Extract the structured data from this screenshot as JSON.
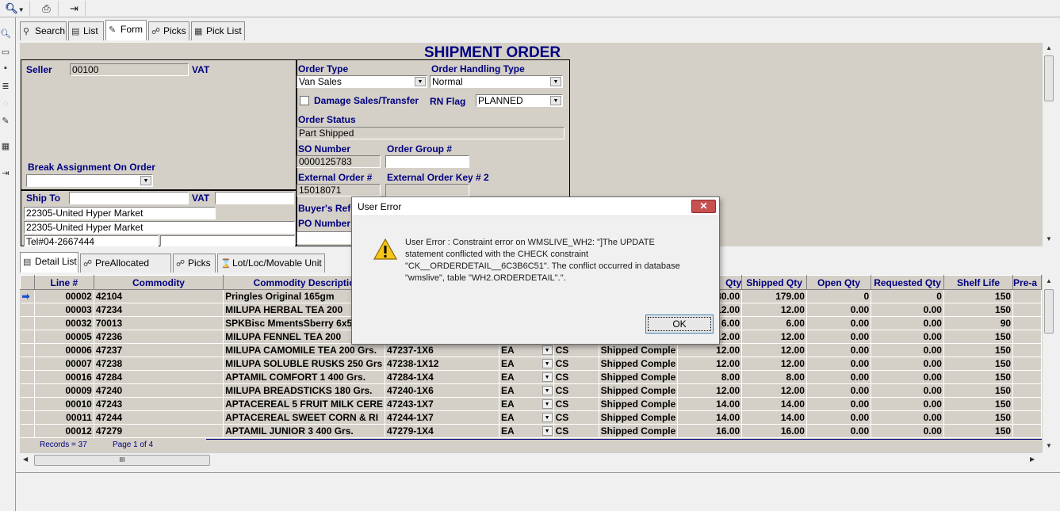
{
  "toolbar": {
    "items": [
      "search-dropdown-icon",
      "print-icon",
      "exit-icon"
    ]
  },
  "main_tabs": [
    {
      "label": "Search",
      "icon": "search-icon"
    },
    {
      "label": "List",
      "icon": "list-icon"
    },
    {
      "label": "Form",
      "icon": "form-icon"
    },
    {
      "label": "Picks",
      "icon": "picks-icon"
    },
    {
      "label": "Pick List",
      "icon": "picklist-icon"
    }
  ],
  "form": {
    "title": "SHIPMENT ORDER",
    "seller_label": "Seller",
    "seller_value": "00100",
    "vat_label": "VAT",
    "break_assignment_label": "Break Assignment On Order",
    "ship_to_label": "Ship To",
    "ship_vat_label": "VAT",
    "ship_line1": "22305-United Hyper Market",
    "ship_line2": "22305-United Hyper Market",
    "ship_line3": "Tel#04-2667444",
    "order_type_label": "Order Type",
    "order_type_value": "Van Sales",
    "handling_type_label": "Order Handling Type",
    "handling_type_value": "Normal",
    "damage_label": "Damage Sales/Transfer",
    "rn_flag_label": "RN Flag",
    "rn_flag_value": "PLANNED",
    "order_status_label": "Order Status",
    "order_status_value": "Part Shipped",
    "so_number_label": "SO Number",
    "so_number_value": "0000125783",
    "order_group_label": "Order Group #",
    "external_order_label": "External Order #",
    "external_order_value": "15018071",
    "external_key2_label": "External Order Key # 2",
    "buyers_ref_label": "Buyer's Refe",
    "po_number_label": "PO Number"
  },
  "detail_tabs": [
    {
      "label": "Detail List",
      "icon": "detail-list-icon"
    },
    {
      "label": "PreAllocated Picks",
      "icon": "preallocated-icon"
    },
    {
      "label": "Picks",
      "icon": "picks-icon"
    },
    {
      "label": "Lot/Loc/Movable Unit",
      "icon": "lot-icon"
    }
  ],
  "grid": {
    "columns": [
      "Line #",
      "Commodity",
      "Commodity Descriptio",
      "",
      "",
      "",
      "",
      "Qty",
      "Shipped Qty",
      "Open Qty",
      "Requested Qty",
      "Shelf Life",
      "Pre-a"
    ],
    "rows": [
      [
        "00002",
        "42104",
        "Pringles Original 165gm",
        "",
        "",
        "",
        "",
        "180.00",
        "179.00",
        "0",
        "0",
        "150"
      ],
      [
        "00003",
        "47234",
        "MILUPA HERBAL TEA 200",
        "",
        "",
        "",
        "",
        "12.00",
        "12.00",
        "0.00",
        "0.00",
        "150"
      ],
      [
        "00032",
        "70013",
        "SPKBisc MmentsSberry 6x5",
        "",
        "",
        "",
        "",
        "6.00",
        "6.00",
        "0.00",
        "0.00",
        "90"
      ],
      [
        "00005",
        "47236",
        "MILUPA FENNEL TEA 200",
        "",
        "",
        "",
        "",
        "12.00",
        "12.00",
        "0.00",
        "0.00",
        "150"
      ],
      [
        "00006",
        "47237",
        "MILUPA CAMOMILE TEA 200 Grs.",
        "47237-1X6",
        "EA",
        "CS",
        "Shipped Comple",
        "12.00",
        "12.00",
        "0.00",
        "0.00",
        "150"
      ],
      [
        "00007",
        "47238",
        "MILUPA SOLUBLE RUSKS 250 Grs",
        "47238-1X12",
        "EA",
        "CS",
        "Shipped Comple",
        "12.00",
        "12.00",
        "0.00",
        "0.00",
        "150"
      ],
      [
        "00016",
        "47284",
        "APTAMIL COMFORT 1 400 Grs.",
        "47284-1X4",
        "EA",
        "CS",
        "Shipped Comple",
        "8.00",
        "8.00",
        "0.00",
        "0.00",
        "150"
      ],
      [
        "00009",
        "47240",
        "MILUPA BREADSTICKS 180 Grs.",
        "47240-1X6",
        "EA",
        "CS",
        "Shipped Comple",
        "12.00",
        "12.00",
        "0.00",
        "0.00",
        "150"
      ],
      [
        "00010",
        "47243",
        "APTACEREAL 5 FRUIT MILK CERE",
        "47243-1X7",
        "EA",
        "CS",
        "Shipped Comple",
        "14.00",
        "14.00",
        "0.00",
        "0.00",
        "150"
      ],
      [
        "00011",
        "47244",
        "APTACEREAL SWEET CORN & RI",
        "47244-1X7",
        "EA",
        "CS",
        "Shipped Comple",
        "14.00",
        "14.00",
        "0.00",
        "0.00",
        "150"
      ],
      [
        "00012",
        "47279",
        "APTAMIL JUNIOR 3 400 Grs.",
        "47279-1X4",
        "EA",
        "CS",
        "Shipped Comple",
        "16.00",
        "16.00",
        "0.00",
        "0.00",
        "150"
      ]
    ]
  },
  "footer": {
    "records": "Records = 37",
    "page": "Page 1 of 4"
  },
  "dialog": {
    "title": "User Error",
    "close": "✕",
    "message_lines": [
      "User Error : Constraint error on WMSLIVE_WH2: \"]The UPDATE",
      "statement conflicted with the CHECK constraint",
      "\"CK__ORDERDETAIL__6C3B6C51\". The conflict occurred in database",
      "\"wmslive\", table \"WH2.ORDERDETAIL\".\"."
    ],
    "ok_label": "OK"
  },
  "hscroll": {
    "thumb": "III"
  }
}
